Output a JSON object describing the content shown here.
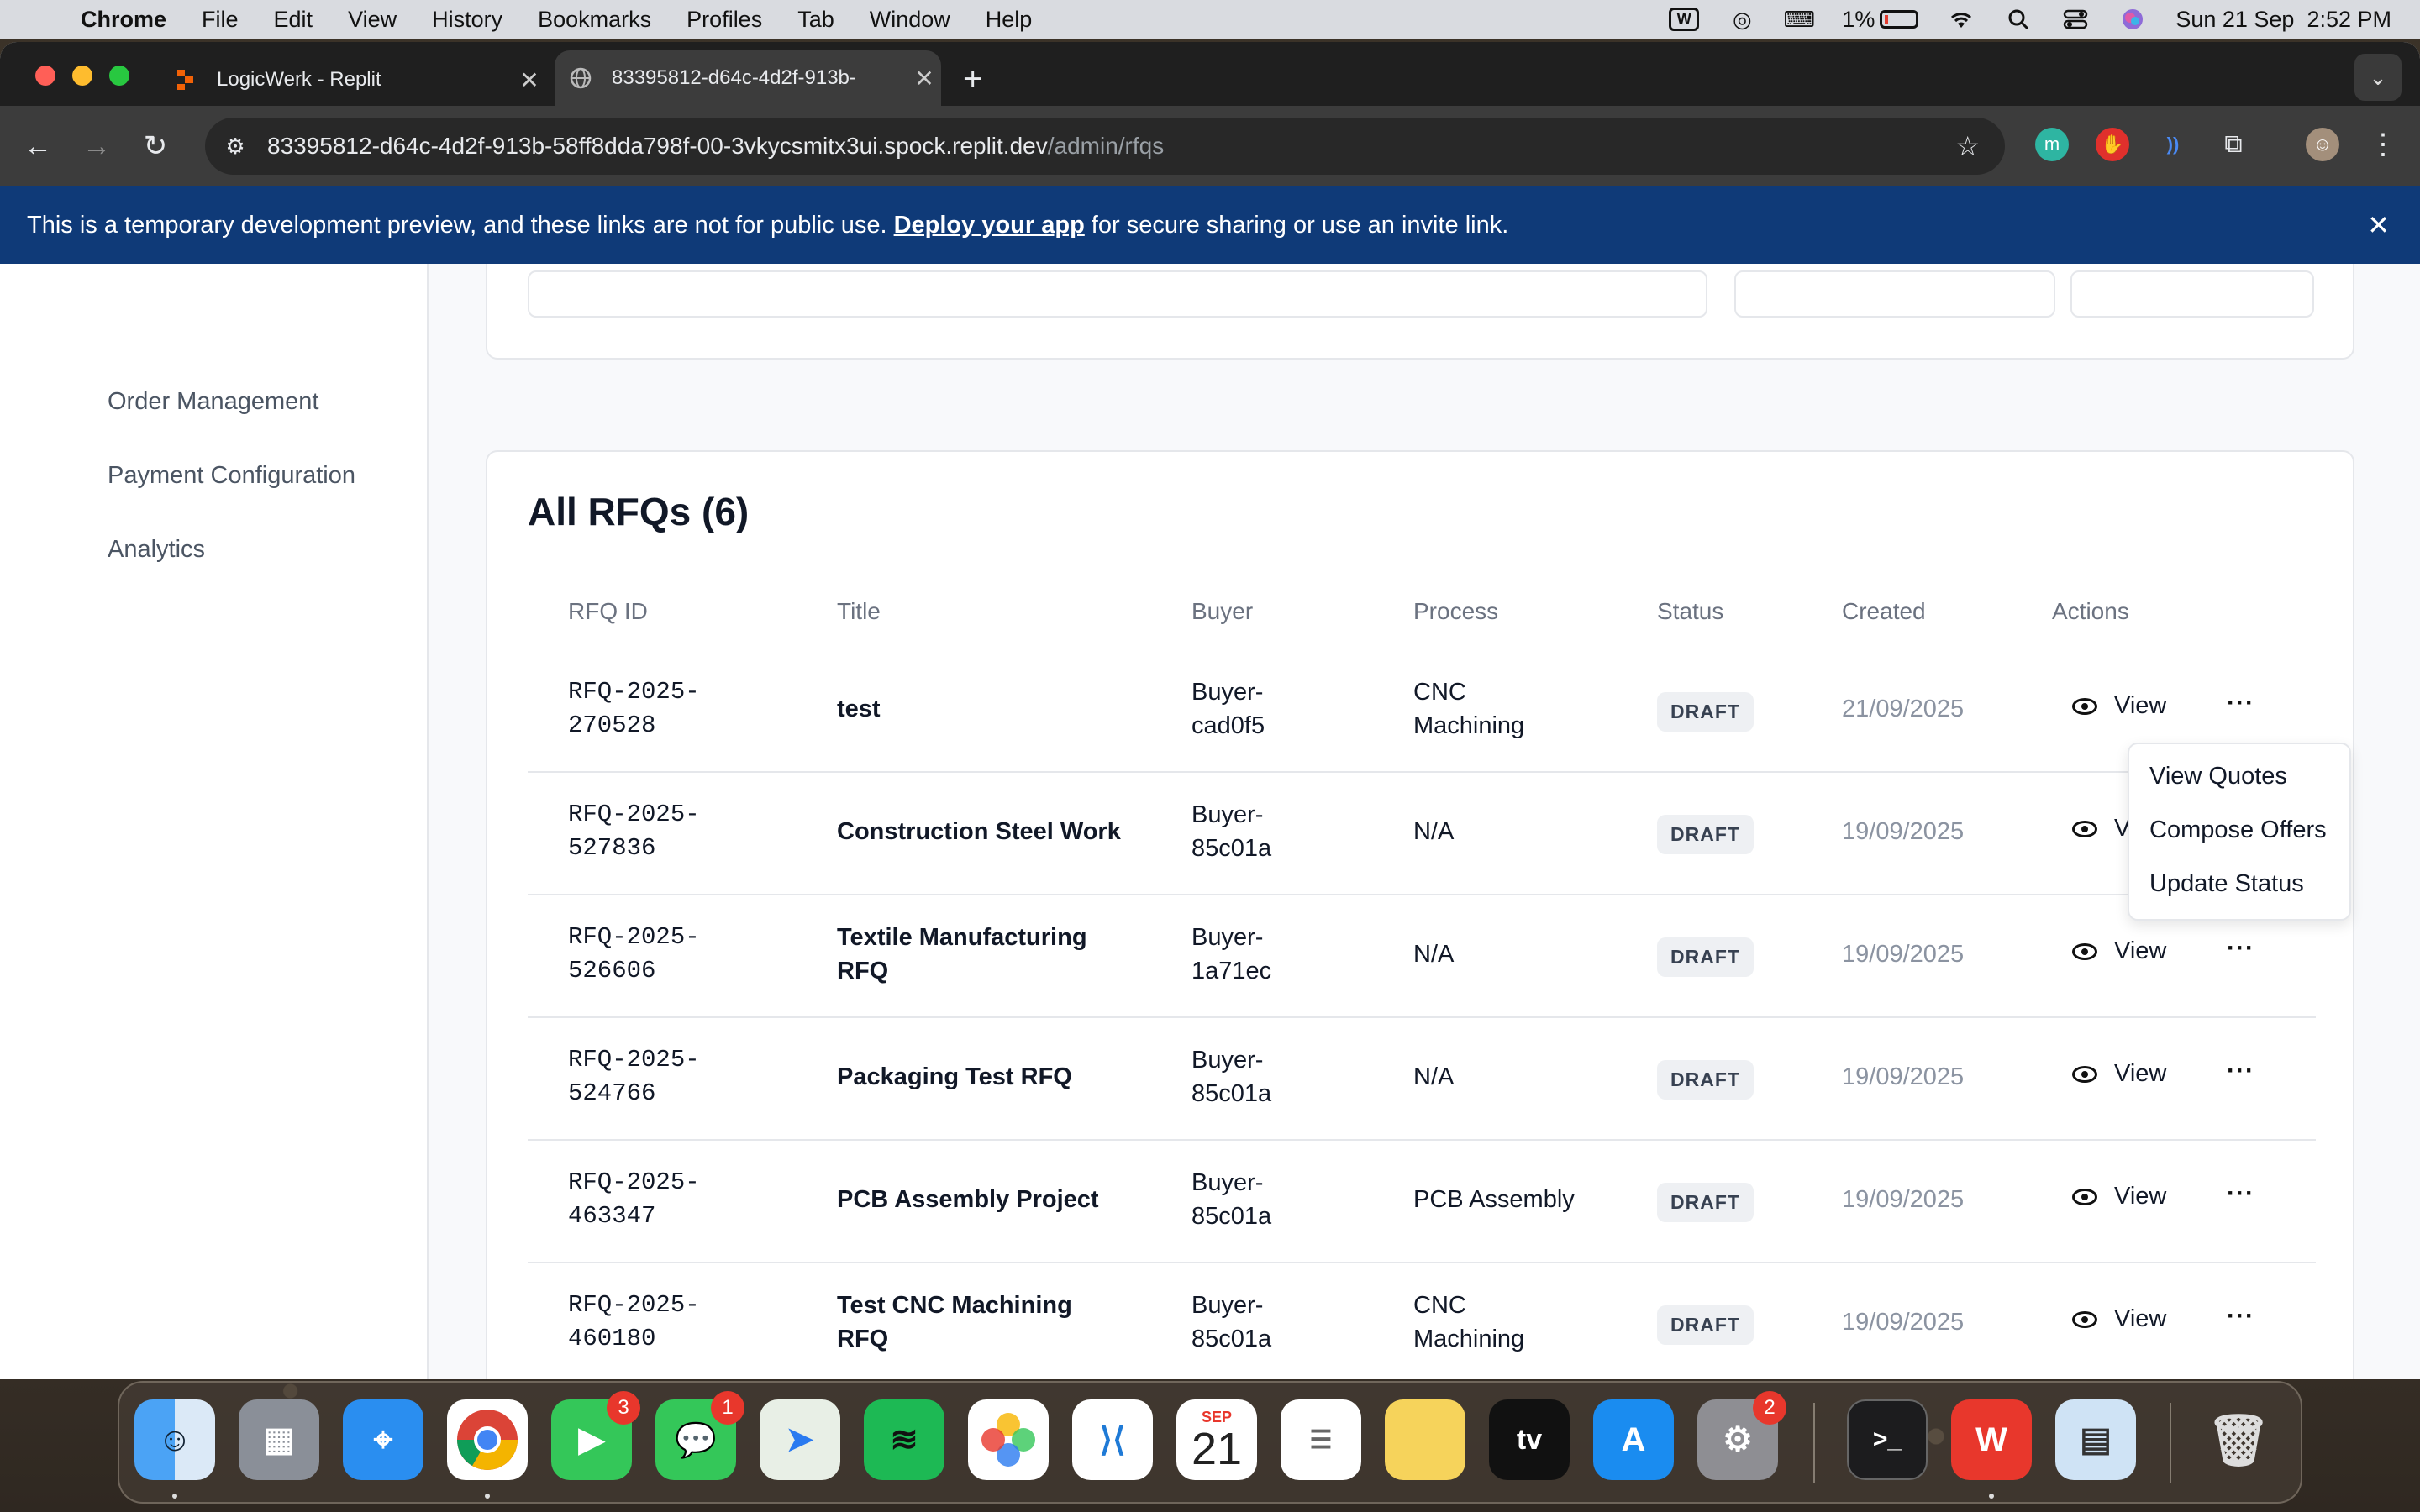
{
  "menubar": {
    "app_name": "Chrome",
    "items": [
      "File",
      "Edit",
      "View",
      "History",
      "Bookmarks",
      "Profiles",
      "Tab",
      "Window",
      "Help"
    ],
    "battery": "1%",
    "datetime": "Sun 21 Sep  2:52 PM"
  },
  "browser": {
    "tabs": [
      {
        "label": "LogicWerk - Replit"
      },
      {
        "label": "83395812-d64c-4d2f-913b-"
      }
    ],
    "url_host": "83395812-d64c-4d2f-913b-58ff8dda798f-00-3vkycsmitx3ui.spock.replit.dev",
    "url_path": "/admin/rfqs"
  },
  "banner": {
    "text_before": "This is a temporary development preview, and these links are not for public use.",
    "link": "Deploy your app",
    "text_after": "for secure sharing or use an invite link."
  },
  "sidebar": {
    "items": [
      "Order Management",
      "Payment Configuration",
      "Analytics"
    ]
  },
  "rfqs": {
    "title": "All RFQs (6)",
    "headers": [
      "RFQ ID",
      "Title",
      "Buyer",
      "Process",
      "Status",
      "Created",
      "Actions"
    ],
    "view_label": "View",
    "rows": [
      {
        "id1": "RFQ-2025-",
        "id2": "270528",
        "title1": "test",
        "title2": "",
        "buyer1": "Buyer-",
        "buyer2": "cad0f5",
        "process1": "CNC",
        "process2": "Machining",
        "status": "DRAFT",
        "created": "21/09/2025"
      },
      {
        "id1": "RFQ-2025-",
        "id2": "527836",
        "title1": "Construction Steel Work",
        "title2": "",
        "buyer1": "Buyer-",
        "buyer2": "85c01a",
        "process1": "N/A",
        "process2": "",
        "status": "DRAFT",
        "created": "19/09/2025"
      },
      {
        "id1": "RFQ-2025-",
        "id2": "526606",
        "title1": "Textile Manufacturing",
        "title2": "RFQ",
        "buyer1": "Buyer-",
        "buyer2": "1a71ec",
        "process1": "N/A",
        "process2": "",
        "status": "DRAFT",
        "created": "19/09/2025"
      },
      {
        "id1": "RFQ-2025-",
        "id2": "524766",
        "title1": "Packaging Test RFQ",
        "title2": "",
        "buyer1": "Buyer-",
        "buyer2": "85c01a",
        "process1": "N/A",
        "process2": "",
        "status": "DRAFT",
        "created": "19/09/2025"
      },
      {
        "id1": "RFQ-2025-",
        "id2": "463347",
        "title1": "PCB Assembly Project",
        "title2": "",
        "buyer1": "Buyer-",
        "buyer2": "85c01a",
        "process1": "PCB Assembly",
        "process2": "",
        "status": "DRAFT",
        "created": "19/09/2025"
      },
      {
        "id1": "RFQ-2025-",
        "id2": "460180",
        "title1": "Test CNC Machining",
        "title2": "RFQ",
        "buyer1": "Buyer-",
        "buyer2": "85c01a",
        "process1": "CNC",
        "process2": "Machining",
        "status": "DRAFT",
        "created": "19/09/2025"
      }
    ]
  },
  "dropdown": {
    "items": [
      "View Quotes",
      "Compose Offers",
      "Update Status"
    ]
  },
  "dock": {
    "calendar_month": "SEP",
    "calendar_day": "21",
    "facetime_badge": "3",
    "messages_badge": "1",
    "settings_badge": "2",
    "appletv_label": "tv"
  },
  "colors": {
    "banner": "#0f3a78",
    "badge_bg": "#eef0f3",
    "date_text": "#8b93a1"
  }
}
